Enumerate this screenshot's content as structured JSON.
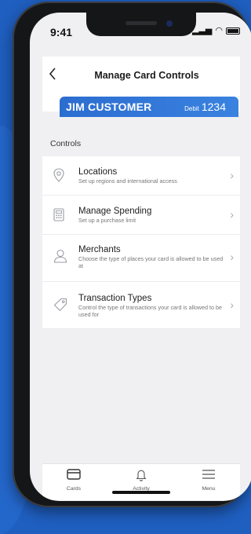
{
  "status": {
    "time": "9:41"
  },
  "header": {
    "title": "Manage Card Controls"
  },
  "card": {
    "name": "JIM CUSTOMER",
    "type": "Debit",
    "last4": "1234"
  },
  "section": {
    "label": "Controls"
  },
  "items": [
    {
      "title": "Locations",
      "subtitle": "Set up regions and international access",
      "icon": "location-pin-icon"
    },
    {
      "title": "Manage Spending",
      "subtitle": "Set up a purchase limit",
      "icon": "calculator-icon"
    },
    {
      "title": "Merchants",
      "subtitle": "Choose the type of places your card is allowed to be used at",
      "icon": "person-icon"
    },
    {
      "title": "Transaction Types",
      "subtitle": "Control the type of transactions your card is allowed to be used for",
      "icon": "tag-icon"
    }
  ],
  "tabs": [
    {
      "label": "Cards",
      "icon": "card-icon"
    },
    {
      "label": "Activity",
      "icon": "bell-icon"
    },
    {
      "label": "Menu",
      "icon": "hamburger-icon"
    }
  ],
  "colors": {
    "background": "#1f5fc0",
    "card": "#2c6dd0"
  }
}
